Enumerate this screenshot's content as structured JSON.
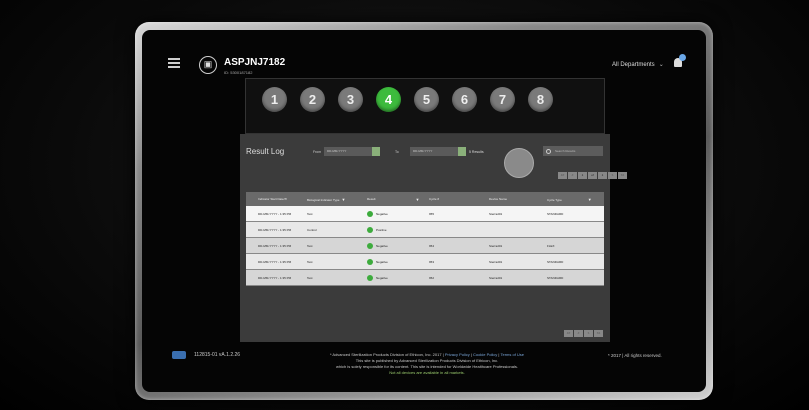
{
  "header": {
    "device_name": "ASPJNJ7182",
    "device_id": "ID: 5300187182",
    "department": "All Departments"
  },
  "steps": [
    "1",
    "2",
    "3",
    "4",
    "5",
    "6",
    "7",
    "8"
  ],
  "active_step": "4",
  "result_log": {
    "title": "Result Log",
    "from_label": "From",
    "to_label": "To",
    "from_placeholder": "DD-MM-YYYY",
    "to_placeholder": "DD-MM-YYYY",
    "results_label": "5 Results",
    "search_placeholder": "Search Results",
    "pager_top": [
      "<<",
      "<",
      "1",
      "of",
      "1",
      ">",
      ">>"
    ],
    "pager_bottom": [
      "<<",
      "<",
      ">",
      ">>"
    ],
    "columns": [
      "Indicator Start Date/Ti",
      "Biological Indicator Type",
      "Result",
      "Cycle #",
      "Device Name",
      "Cycle Type"
    ],
    "rows": [
      {
        "date": "DD-MM-YYYY - 1:35 PM",
        "type": "Test",
        "result": "Negative",
        "cycle": "955",
        "device": "Sterrad01",
        "cycle_type": "STANDARD"
      },
      {
        "date": "DD-MM-YYYY - 1:35 PM",
        "type": "Control",
        "result": "Positive",
        "cycle": "",
        "device": "",
        "cycle_type": ""
      },
      {
        "date": "DD-MM-YYYY - 1:35 PM",
        "type": "Test",
        "result": "Negative",
        "cycle": "954",
        "device": "Sterrad01",
        "cycle_type": "FLEX"
      },
      {
        "date": "DD-MM-YYYY - 1:35 PM",
        "type": "Test",
        "result": "Negative",
        "cycle": "953",
        "device": "Sterrad01",
        "cycle_type": "STANDARD"
      },
      {
        "date": "DD-MM-YYYY - 1:35 PM",
        "type": "Test",
        "result": "Negative",
        "cycle": "952",
        "device": "Sterrad01",
        "cycle_type": "STANDARD"
      }
    ]
  },
  "footer": {
    "version": "112815-01 vA.1.2.26",
    "line1_prefix": "* Advanced Sterilization Products Division of Ethicon, Inc. 2017 |",
    "privacy": "Privacy Policy",
    "cookie": "Cookie Policy",
    "terms": "Terms of Use",
    "line2": "This site is published by Advanced Sterilization Products Division of Ethicon, Inc.",
    "line3": "which is solely responsible for its content. This site is intended for Worldwide Healthcare Professionals.",
    "line4": "Not all devices are available in all markets.",
    "copyright": "* 2017 | All rights reserved."
  },
  "colors": {
    "active_step": "#3dbb3d",
    "inactive_step": "#7a7a7a",
    "panel_bg": "#3b3b3b",
    "link": "#7aa6d8",
    "success": "#3dab3d"
  }
}
